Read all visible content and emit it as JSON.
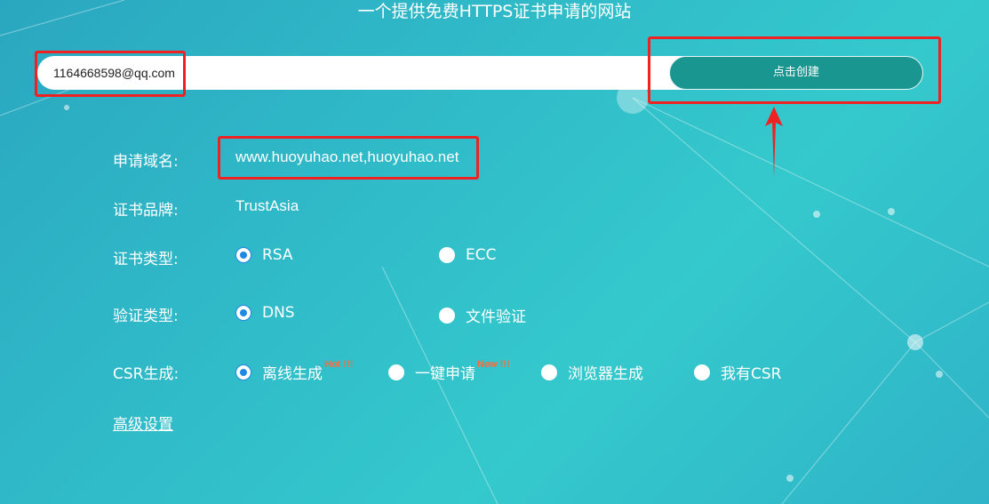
{
  "header": {
    "title": "一个提供免费HTTPS证书申请的网站"
  },
  "form": {
    "email_value": "1164668598@qq.com",
    "create_label": "点击创建",
    "domain_label": "申请域名:",
    "domain_value": "www.huoyuhao.net,huoyuhao.net",
    "brand_label": "证书品牌:",
    "brand_value": "TrustAsia",
    "cert_type_label": "证书类型:",
    "cert_type_options": [
      {
        "label": "RSA",
        "checked": true
      },
      {
        "label": "ECC",
        "checked": false
      }
    ],
    "verify_type_label": "验证类型:",
    "verify_type_options": [
      {
        "label": "DNS",
        "checked": true
      },
      {
        "label": "文件验证",
        "checked": false
      }
    ],
    "csr_label": "CSR生成:",
    "csr_options": [
      {
        "label": "离线生成",
        "badge": "Hot !!!",
        "checked": true
      },
      {
        "label": "一键申请",
        "badge": "New !!!",
        "checked": false
      },
      {
        "label": "浏览器生成",
        "checked": false
      },
      {
        "label": "我有CSR",
        "checked": false
      }
    ],
    "advanced_label": "高级设置"
  },
  "colors": {
    "accent_button": "#199690",
    "radio_checked": "#1e88e5",
    "annotation_red": "#ee2222",
    "badge": "#ff6a3d"
  }
}
